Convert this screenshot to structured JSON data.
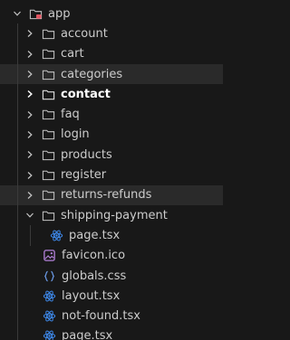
{
  "explorer": {
    "root": {
      "label": "app",
      "expanded": true
    },
    "items": [
      {
        "label": "account",
        "type": "folder",
        "expanded": false
      },
      {
        "label": "cart",
        "type": "folder",
        "expanded": false
      },
      {
        "label": "categories",
        "type": "folder",
        "expanded": false
      },
      {
        "label": "contact",
        "type": "folder",
        "expanded": false
      },
      {
        "label": "faq",
        "type": "folder",
        "expanded": false
      },
      {
        "label": "login",
        "type": "folder",
        "expanded": false
      },
      {
        "label": "products",
        "type": "folder",
        "expanded": false
      },
      {
        "label": "register",
        "type": "folder",
        "expanded": false
      },
      {
        "label": "returns-refunds",
        "type": "folder",
        "expanded": false
      },
      {
        "label": "shipping-payment",
        "type": "folder",
        "expanded": true
      },
      {
        "label": "page.tsx",
        "type": "react-file"
      },
      {
        "label": "favicon.ico",
        "type": "image-file"
      },
      {
        "label": "globals.css",
        "type": "css-file"
      },
      {
        "label": "layout.tsx",
        "type": "react-file"
      },
      {
        "label": "not-found.tsx",
        "type": "react-file"
      },
      {
        "label": "page.tsx",
        "type": "react-file"
      }
    ]
  },
  "colors": {
    "react_icon": "#3f8cf0",
    "css_icon": "#6b9be8",
    "image_icon": "#b180d7",
    "app_folder_badge": "#e05561",
    "highlight_row": "#2a2a2a"
  }
}
